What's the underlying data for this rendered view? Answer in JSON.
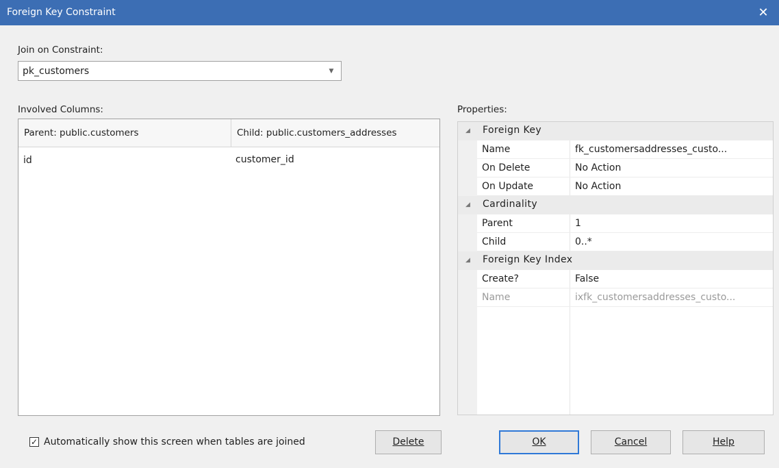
{
  "window": {
    "title": "Foreign Key Constraint",
    "close_glyph": "✕"
  },
  "join": {
    "label": "Join on Constraint:",
    "value": "pk_customers"
  },
  "columns": {
    "label": "Involved Columns:",
    "headers": [
      "Parent: public.customers",
      "Child: public.customers_addresses"
    ],
    "rows": [
      {
        "parent": "id",
        "child": "customer_id"
      }
    ]
  },
  "properties": {
    "label": "Properties:",
    "categories": [
      {
        "title": "Foreign Key",
        "items": [
          {
            "key": "Name",
            "value": "fk_customersaddresses_custo..."
          },
          {
            "key": "On Delete",
            "value": "No Action"
          },
          {
            "key": "On Update",
            "value": "No Action"
          }
        ]
      },
      {
        "title": "Cardinality",
        "items": [
          {
            "key": "Parent",
            "value": "1"
          },
          {
            "key": "Child",
            "value": "0..*"
          }
        ]
      },
      {
        "title": "Foreign Key Index",
        "items": [
          {
            "key": "Create?",
            "value": "False"
          },
          {
            "key": "Name",
            "value": "ixfk_customersaddresses_custo..."
          }
        ]
      }
    ]
  },
  "footer": {
    "auto_show_label": "Automatically show this screen when tables are joined",
    "auto_show_checked": true,
    "delete_label": "Delete",
    "ok_label": "OK",
    "cancel_label": "Cancel",
    "help_label": "Help"
  }
}
